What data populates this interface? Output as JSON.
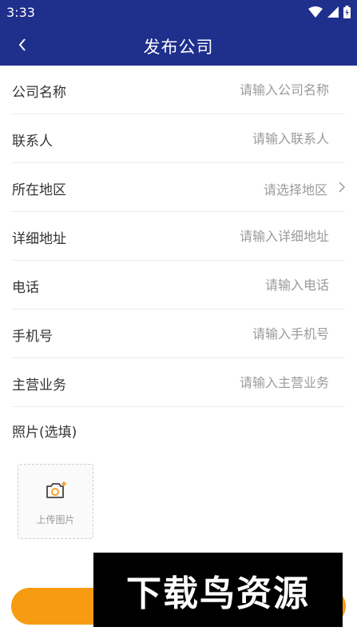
{
  "status_bar": {
    "time": "3:33"
  },
  "header": {
    "title": "发布公司",
    "back_icon": "chevron-left-icon"
  },
  "form": {
    "rows": [
      {
        "label": "公司名称",
        "placeholder": "请输入公司名称",
        "value": ""
      },
      {
        "label": "联系人",
        "placeholder": "请输入联系人",
        "value": ""
      },
      {
        "label": "所在地区",
        "select_text": "请选择地区"
      },
      {
        "label": "详细地址",
        "placeholder": "请输入详细地址",
        "value": ""
      },
      {
        "label": "电话",
        "placeholder": "请输入电话",
        "value": ""
      },
      {
        "label": "手机号",
        "placeholder": "请输入手机号",
        "value": ""
      },
      {
        "label": "主营业务",
        "placeholder": "请输入主营业务",
        "value": ""
      }
    ]
  },
  "photo": {
    "label": "照片(选填)",
    "upload_text": "上传图片"
  },
  "watermark": {
    "text": "下载鸟资源"
  },
  "colors": {
    "header_bg": "#1f2f8c",
    "accent": "#f79b12",
    "placeholder": "#9a9a9a"
  }
}
